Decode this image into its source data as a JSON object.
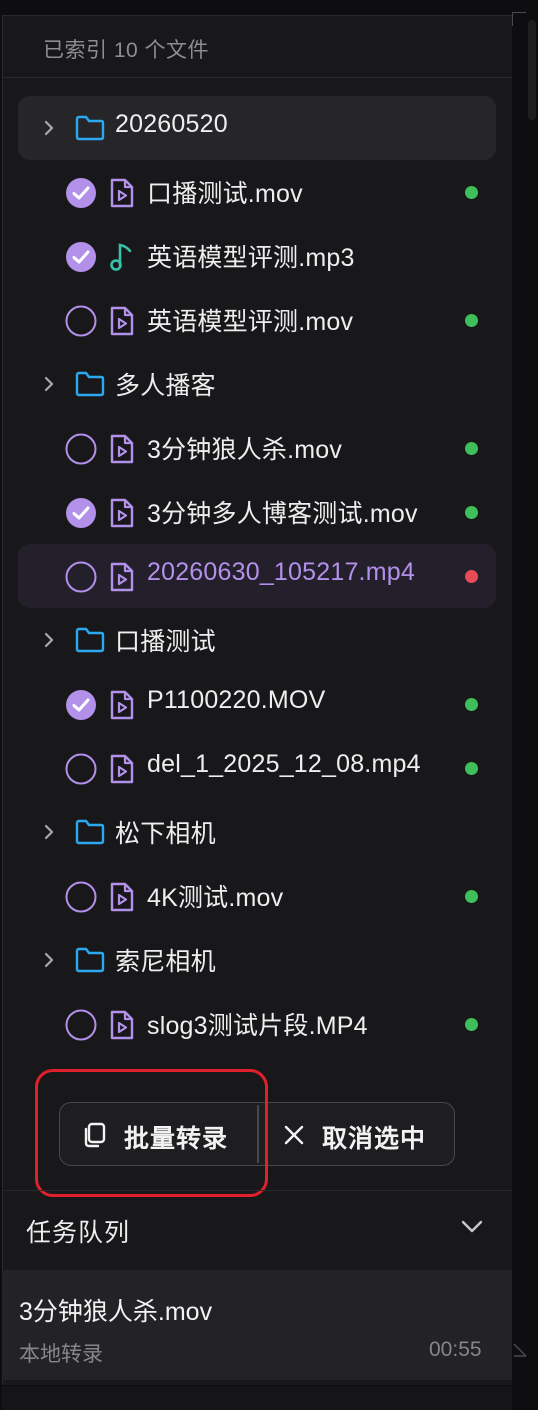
{
  "header": {
    "index_status": "已索引 10 个文件"
  },
  "tree": [
    {
      "kind": "folder",
      "label": "20260520",
      "highlighted": true
    },
    {
      "kind": "file",
      "label": "口播测试.mov",
      "checked": true,
      "icon": "video-file-icon",
      "status": "green"
    },
    {
      "kind": "file",
      "label": "英语模型评测.mp3",
      "checked": true,
      "icon": "music-note-icon",
      "status": "none"
    },
    {
      "kind": "file",
      "label": "英语模型评测.mov",
      "checked": false,
      "icon": "video-file-icon",
      "status": "green"
    },
    {
      "kind": "folder",
      "label": "多人播客"
    },
    {
      "kind": "file",
      "label": "3分钟狼人杀.mov",
      "checked": false,
      "icon": "video-file-icon",
      "status": "green"
    },
    {
      "kind": "file",
      "label": "3分钟多人博客测试.mov",
      "checked": true,
      "icon": "video-file-icon",
      "status": "green"
    },
    {
      "kind": "file",
      "label": "20260630_105217.mp4",
      "checked": false,
      "icon": "video-file-icon",
      "status": "red",
      "active": true
    },
    {
      "kind": "folder",
      "label": "口播测试"
    },
    {
      "kind": "file",
      "label": "P1100220.MOV",
      "checked": true,
      "icon": "video-file-icon",
      "status": "green"
    },
    {
      "kind": "file",
      "label": "del_1_2025_12_08.mp4",
      "checked": false,
      "icon": "video-file-icon",
      "status": "green"
    },
    {
      "kind": "folder",
      "label": "松下相机"
    },
    {
      "kind": "file",
      "label": "4K测试.mov",
      "checked": false,
      "icon": "video-file-icon",
      "status": "green"
    },
    {
      "kind": "folder",
      "label": "索尼相机"
    },
    {
      "kind": "file",
      "label": "slog3测试片段.MP4",
      "checked": false,
      "icon": "video-file-icon",
      "status": "green"
    }
  ],
  "actions": {
    "batch_label": "批量转录",
    "clear_label": "取消选中"
  },
  "queue": {
    "title": "任务队列",
    "task": {
      "name": "3分钟狼人杀.mov",
      "type": "本地转录",
      "time": "00:55"
    }
  },
  "colors": {
    "accent_purple": "#b390ea",
    "folder_blue": "#2aa8f2",
    "music_teal": "#36c3a8",
    "status_green": "#3fbf5a",
    "status_red": "#e84b55",
    "annotation_red": "#e0202a"
  }
}
